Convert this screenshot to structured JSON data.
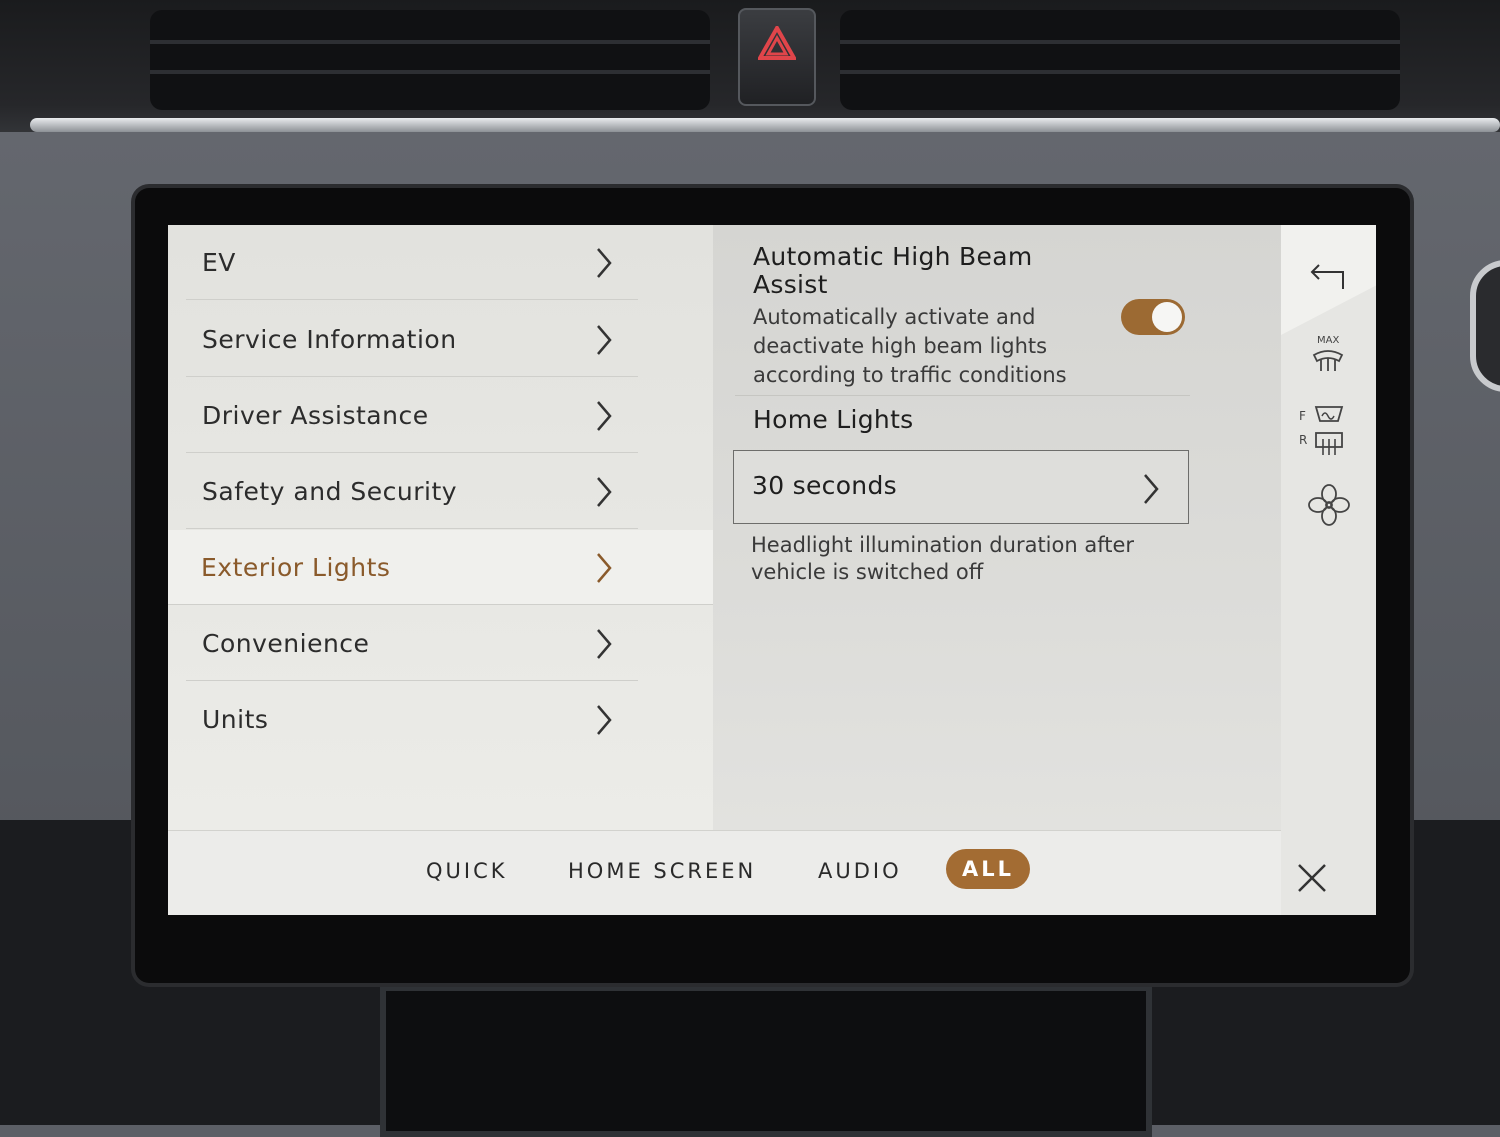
{
  "menu": {
    "items": [
      {
        "label": "EV",
        "active": false
      },
      {
        "label": "Service Information",
        "active": false
      },
      {
        "label": "Driver Assistance",
        "active": false
      },
      {
        "label": "Safety and Security",
        "active": false
      },
      {
        "label": "Exterior Lights",
        "active": true
      },
      {
        "label": "Convenience",
        "active": false
      },
      {
        "label": "Units",
        "active": false
      }
    ]
  },
  "settings": {
    "auto_high_beam": {
      "title": "Automatic High Beam Assist",
      "description": "Automatically activate and deactivate high beam lights according to traffic conditions",
      "enabled": true
    },
    "home_lights": {
      "title": "Home Lights",
      "value": "30 seconds",
      "help": "Headlight illumination duration after vehicle is switched off"
    }
  },
  "climate_strip": {
    "max_defrost_label": "MAX",
    "front_label": "F",
    "rear_label": "R",
    "icons": [
      "back-icon",
      "max-defrost-icon",
      "front-defrost-icon",
      "rear-defrost-icon",
      "fan-icon"
    ]
  },
  "tabs": [
    {
      "label": "QUICK",
      "active": false
    },
    {
      "label": "HOME SCREEN",
      "active": false
    },
    {
      "label": "AUDIO",
      "active": false
    },
    {
      "label": "ALL",
      "active": true
    }
  ],
  "colors": {
    "accent": "#a36c33",
    "active_text": "#8a5a2b",
    "toggle_on": "#9c6a33"
  }
}
